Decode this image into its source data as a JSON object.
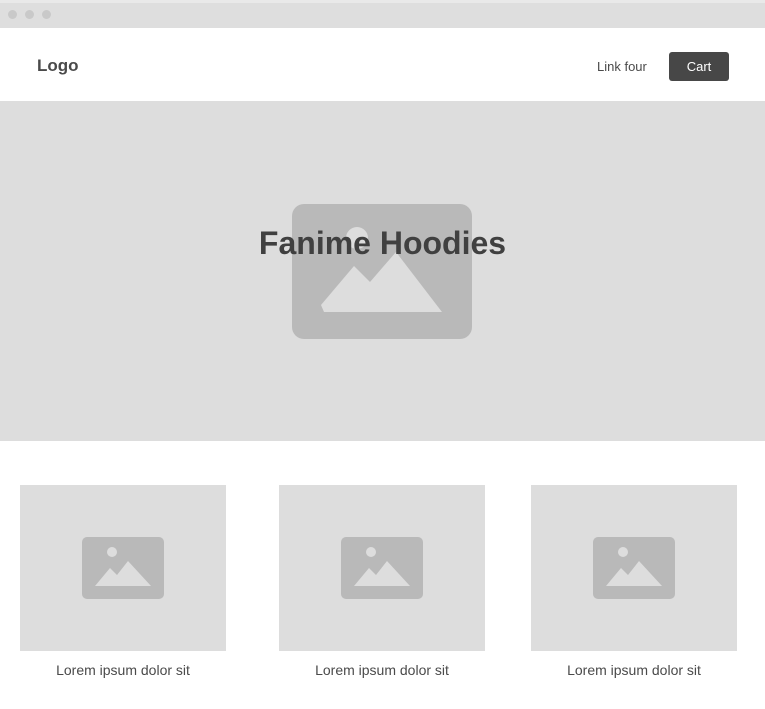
{
  "header": {
    "logo": "Logo",
    "nav_link": "Link four",
    "cart_label": "Cart"
  },
  "hero": {
    "title": "Fanime Hoodies",
    "image_icon": "image-placeholder-icon"
  },
  "products": [
    {
      "caption": "Lorem ipsum dolor sit",
      "image_icon": "image-placeholder-icon"
    },
    {
      "caption": "Lorem ipsum dolor sit",
      "image_icon": "image-placeholder-icon"
    },
    {
      "caption": "Lorem ipsum dolor sit",
      "image_icon": "image-placeholder-icon"
    }
  ],
  "colors": {
    "placeholder_bg": "#dddddd",
    "placeholder_icon": "#b9b9b9",
    "button_bg": "#474747",
    "text": "#4a4a4a"
  }
}
